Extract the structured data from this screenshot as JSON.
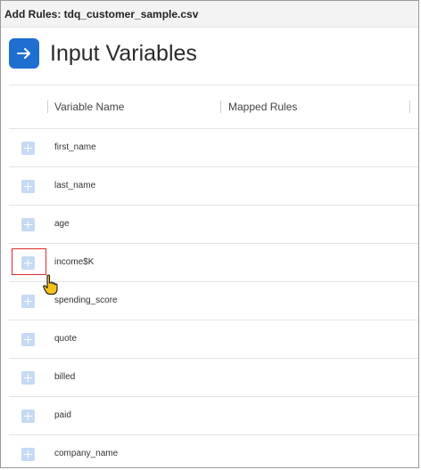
{
  "window": {
    "title": "Add Rules: tdq_customer_sample.csv"
  },
  "page": {
    "title": "Input Variables",
    "accent_color": "#1f6fd1"
  },
  "table": {
    "columns": [
      "Variable Name",
      "Mapped Rules"
    ],
    "rows": [
      {
        "variable": "first_name"
      },
      {
        "variable": "last_name"
      },
      {
        "variable": "age"
      },
      {
        "variable": "income$K"
      },
      {
        "variable": "spending_score"
      },
      {
        "variable": "quote"
      },
      {
        "variable": "billed"
      },
      {
        "variable": "paid"
      },
      {
        "variable": "company_name"
      }
    ],
    "highlighted_row": 3
  }
}
